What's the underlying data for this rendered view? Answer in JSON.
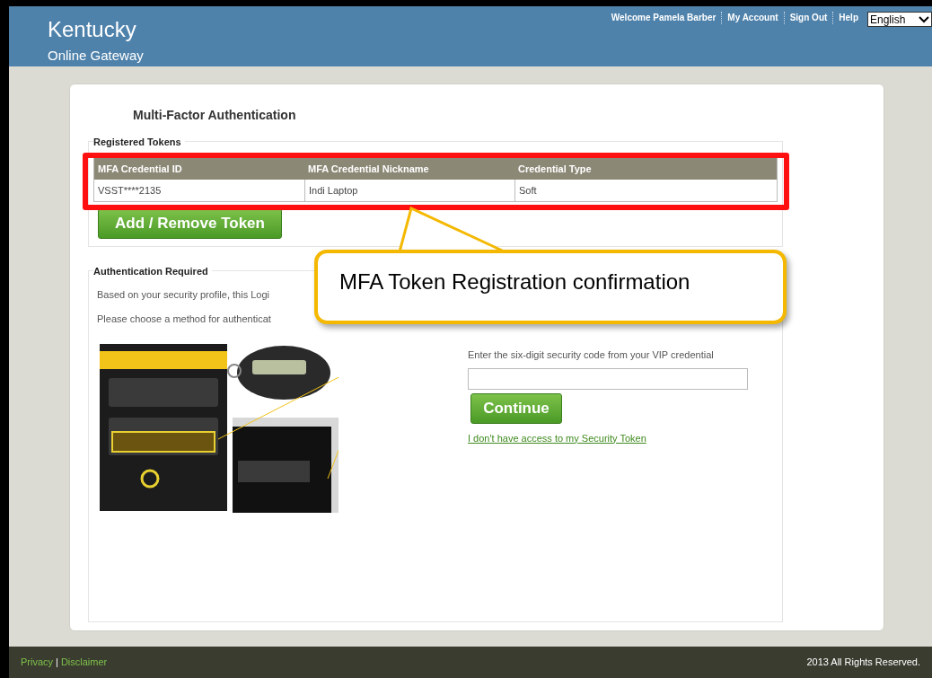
{
  "header": {
    "title": "Kentucky",
    "subtitle": "Online Gateway",
    "links": [
      "Welcome Pamela Barber",
      "My Account",
      "Sign Out",
      "Help"
    ],
    "language": "English"
  },
  "page_title": "Multi-Factor Authentication",
  "tokens": {
    "legend": "Registered Tokens",
    "columns": [
      "MFA Credential ID",
      "MFA Credential Nickname",
      "Credential Type"
    ],
    "rows": [
      [
        "VSST****2135",
        "Indi Laptop",
        "Soft"
      ]
    ],
    "button": "Add / Remove Token"
  },
  "auth": {
    "legend": "Authentication Required",
    "lines": [
      "Based on your security profile, this Logi",
      "Please choose a method for authenticat"
    ],
    "code_label": "Enter the six-digit security code from your VIP credential",
    "button": "Continue",
    "link": "I don't have access to my Security Token"
  },
  "callout": {
    "text": "MFA Token Registration confirmation"
  },
  "footer": {
    "links": [
      "Privacy",
      "Disclaimer"
    ],
    "separator": "|",
    "copyright": "2013 All Rights Reserved."
  }
}
